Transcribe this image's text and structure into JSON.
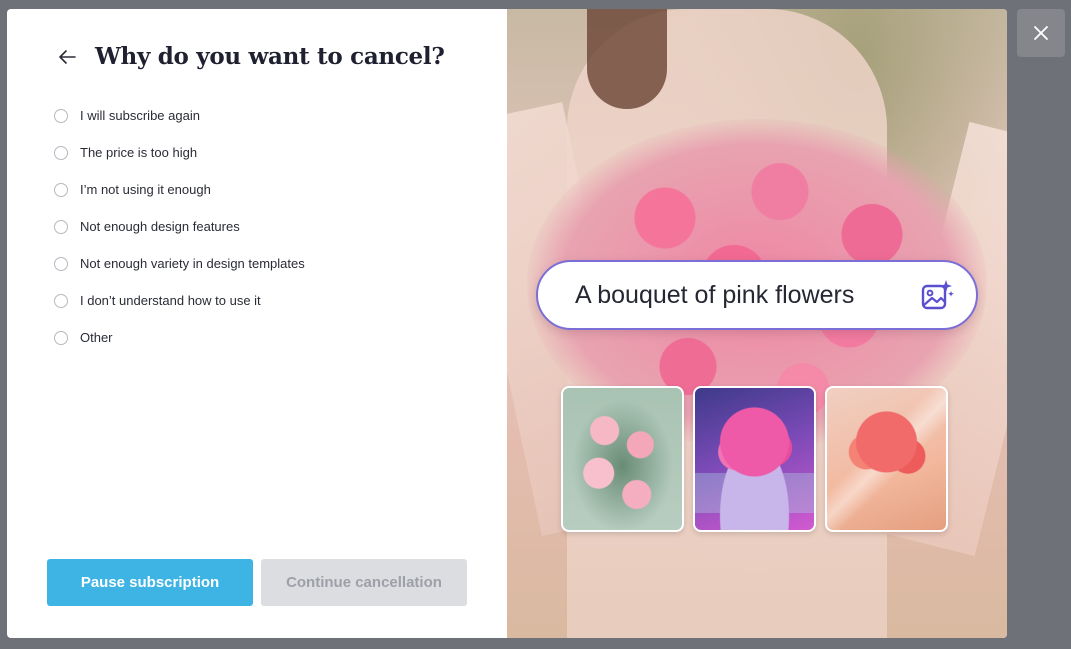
{
  "modal": {
    "title": "Why do you want to cancel?",
    "options": [
      {
        "label": "I will subscribe again"
      },
      {
        "label": "The price is too high"
      },
      {
        "label": "I’m not using it enough"
      },
      {
        "label": "Not enough design features"
      },
      {
        "label": "Not enough variety in design templates"
      },
      {
        "label": "I don’t understand how to use it"
      },
      {
        "label": "Other"
      }
    ],
    "primary_button": "Pause subscription",
    "secondary_button": "Continue cancellation"
  },
  "promo": {
    "prompt_text": "A bouquet of pink flowers",
    "prompt_icon": "ai-image-icon",
    "thumbnails": [
      "pink-peony-illustration",
      "pink-flowers-in-vase",
      "pink-bouquet-in-wrap"
    ]
  },
  "colors": {
    "accent": "#3db4e4",
    "disabled": "#dcdde1",
    "prompt_border": "#7b6ed6",
    "overlay": "#6f7178"
  },
  "icons": {
    "back": "arrow-left-icon",
    "close": "close-icon"
  }
}
